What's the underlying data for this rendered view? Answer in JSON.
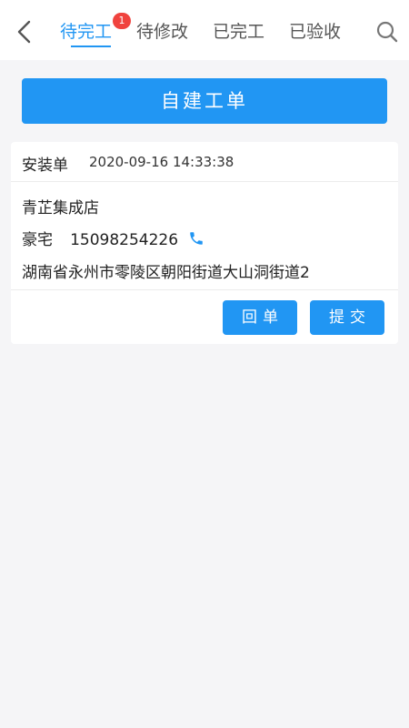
{
  "header": {
    "tabs": [
      {
        "label": "待完工",
        "badge": "1"
      },
      {
        "label": "待修改"
      },
      {
        "label": "已完工"
      },
      {
        "label": "已验收"
      }
    ],
    "back_icon": "chevron-left-icon",
    "search_icon": "search-icon"
  },
  "create_button": {
    "label": "自建工单"
  },
  "order": {
    "type": "安装单",
    "time": "2020-09-16 14:33:38",
    "store": "青芷集成店",
    "contact_name": "豪宅",
    "phone": "15098254226",
    "phone_icon": "phone-icon",
    "address": "湖南省永州市零陵区朝阳街道大山洞街道2",
    "buttons": {
      "reply": "回单",
      "submit": "提交"
    }
  },
  "colors": {
    "accent": "#2196f3",
    "badge": "#f0433e",
    "background": "#f5f5f7"
  }
}
